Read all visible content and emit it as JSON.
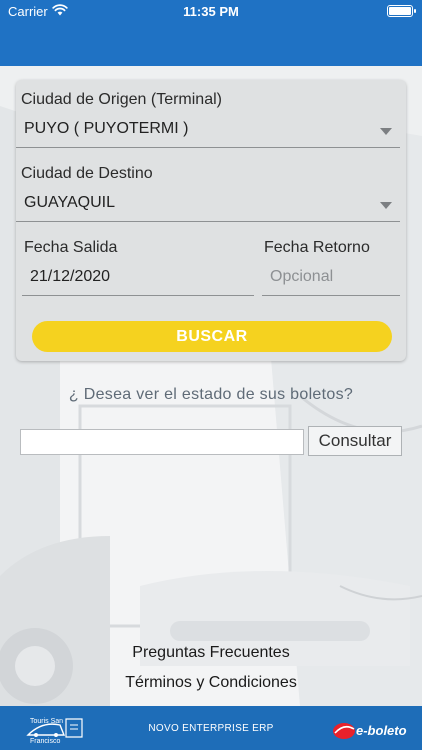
{
  "status_bar": {
    "carrier": "Carrier",
    "time": "11:35 PM",
    "wifi_icon": "wifi-icon",
    "battery_icon": "battery-icon"
  },
  "theme": {
    "primary": "#1f72c4",
    "accent": "#f5d21f",
    "footer": "#1e6db8",
    "card": "#dfe1e2"
  },
  "form": {
    "origin_label": "Ciudad de Origen (Terminal)",
    "origin_value": "PUYO ( PUYOTERMI )",
    "destination_label": "Ciudad de Destino",
    "destination_value": "GUAYAQUIL",
    "departure_label": "Fecha Salida",
    "departure_value": "21/12/2020",
    "return_label": "Fecha Retorno",
    "return_placeholder": "Opcional",
    "search_button": "BUSCAR"
  },
  "ticket_status": {
    "question": "¿ Desea ver el estado de sus boletos?",
    "input_value": "",
    "consult_button": "Consultar"
  },
  "links": {
    "faq": "Preguntas Frecuentes",
    "terms": "Términos y Condiciones"
  },
  "footer": {
    "erp_text": "NOVO ENTERPRISE ERP",
    "brand": "e-boleto",
    "logo_line1": "Touris San",
    "logo_line2": "Francisco"
  }
}
